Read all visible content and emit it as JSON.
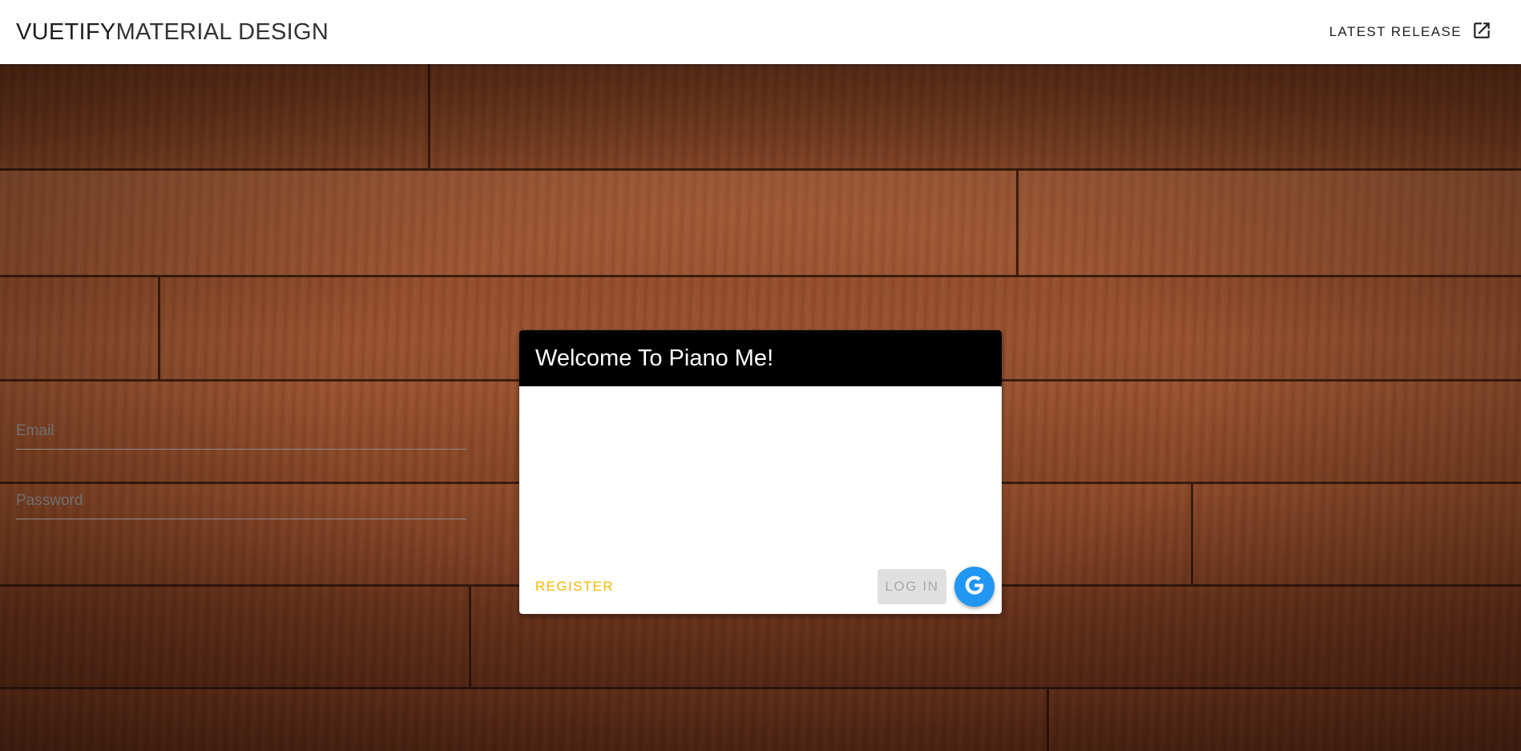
{
  "app_bar": {
    "brand_bold": "VUETIFY",
    "brand_light": "MATERIAL DESIGN",
    "release_label": "LATEST RELEASE",
    "release_icon": "open-in-new-icon"
  },
  "background": {
    "description_icon": "wood-plank-background"
  },
  "login_card": {
    "title": "Welcome To Piano Me!",
    "email_placeholder": "Email",
    "password_placeholder": "Password",
    "register_label": "REGISTER",
    "login_label": "LOG IN",
    "google_icon": "google-icon"
  },
  "colors": {
    "card_header": "#000000",
    "register_text": "#f5b800",
    "login_disabled_bg": "#e0e0e0",
    "google_button": "#2196f3"
  }
}
